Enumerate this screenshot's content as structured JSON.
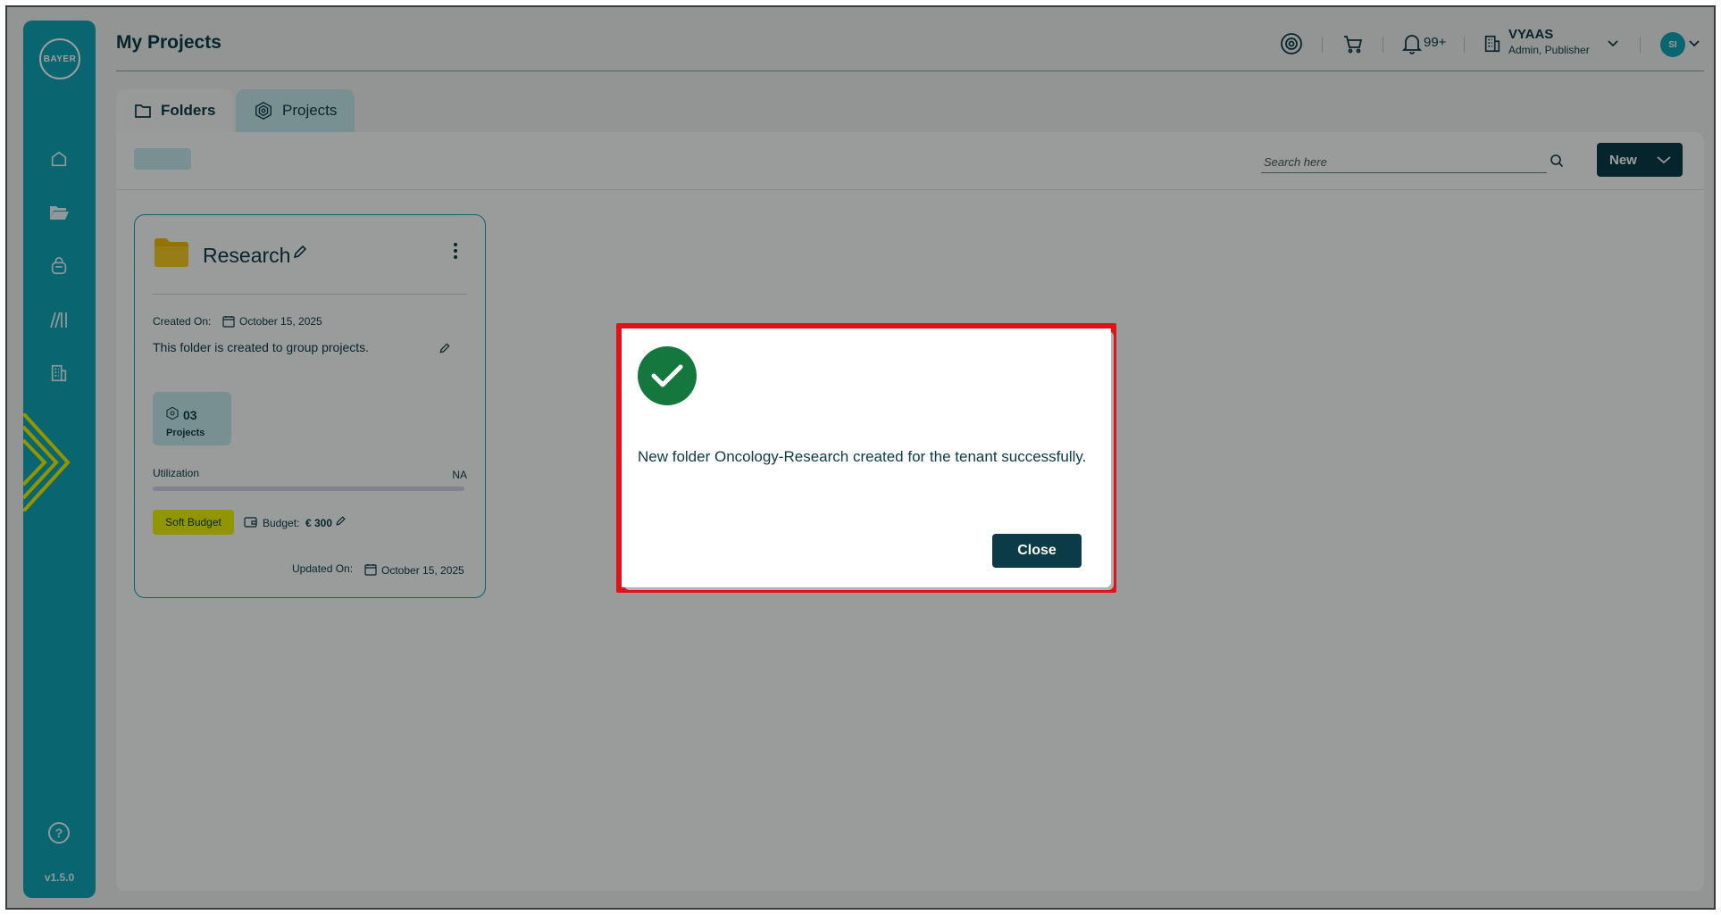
{
  "app": {
    "logo_text_h": "BAYER",
    "logo_text_v": "BAYER",
    "version": "v1.5.0"
  },
  "header": {
    "page_title": "My Projects",
    "notifications_count": "99+",
    "tenant_name": "VYAAS",
    "tenant_roles": "Admin, Publisher",
    "avatar_initials": "SI"
  },
  "tabs": [
    {
      "label": "Folders",
      "active": true
    },
    {
      "label": "Projects",
      "active": false
    }
  ],
  "toolbar": {
    "search_placeholder": "Search here",
    "new_label": "New"
  },
  "folder_card": {
    "name": "Research",
    "created_label": "Created On:",
    "created_date": "October 15, 2025",
    "description": "This folder is created to group projects.",
    "projects_count": "03",
    "projects_label": "Projects",
    "utilization_label": "Utilization",
    "utilization_value": "NA",
    "budget_type": "Soft Budget",
    "budget_label": "Budget:",
    "budget_value": "€ 300",
    "updated_label": "Updated On:",
    "updated_date": "October 15, 2025"
  },
  "dialog": {
    "message": "New folder Oncology-Research created for the tenant successfully.",
    "close_label": "Close"
  },
  "colors": {
    "teal": "#10a3b5",
    "dark_teal": "#0b3b46",
    "success_green": "#14773d",
    "highlight_red": "#e3121a",
    "badge_yellow": "#eaf300"
  }
}
